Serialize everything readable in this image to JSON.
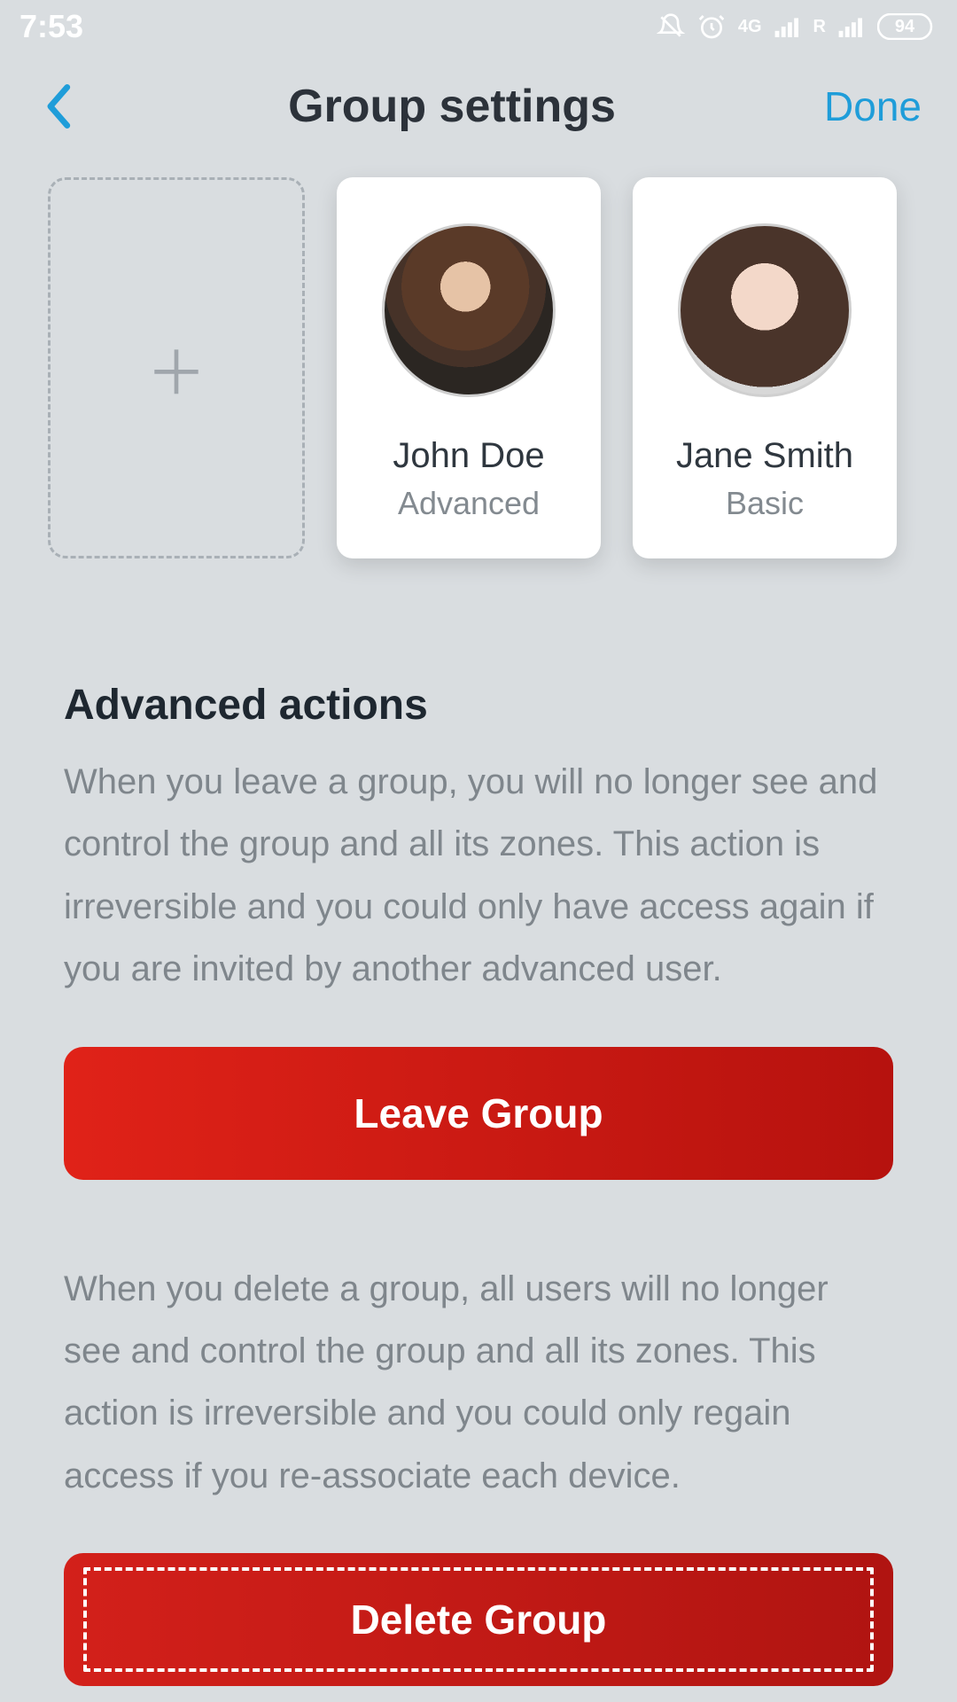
{
  "status": {
    "time": "7:53",
    "battery": "94"
  },
  "header": {
    "title": "Group settings",
    "done": "Done"
  },
  "members": {
    "items": [
      {
        "name": "John Doe",
        "role": "Advanced"
      },
      {
        "name": "Jane Smith",
        "role": "Basic"
      }
    ]
  },
  "advanced": {
    "title": "Advanced actions",
    "leave_desc": "When you leave a group, you will no longer see and control the group and all its zones. This action is irreversible and you could only have access again if you are invited by another advanced user.",
    "leave_btn": "Leave Group",
    "delete_desc": "When you delete a group, all users will no longer see and control the group and all its zones. This action is irreversible and you could only regain access if you re-associate each device.",
    "delete_btn": "Delete Group"
  }
}
